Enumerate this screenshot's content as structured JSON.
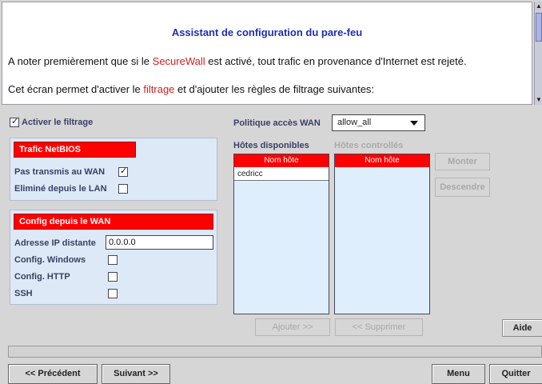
{
  "info": {
    "title": "Assistant de configuration du pare-feu",
    "line1_pre": "A noter premièrement que si le ",
    "line1_link": "SecureWall",
    "line1_post": " est activé, tout trafic en provenance d'Internet est rejeté.",
    "line2_pre": "Cet écran permet d'activer le ",
    "line2_link": "filtrage",
    "line2_post": " et d'ajouter les règles de filtrage suivantes:"
  },
  "filter": {
    "enable_label": "Activer le filtrage",
    "enabled": true
  },
  "netbios": {
    "header": "Trafic NetBIOS",
    "not_sent_wan_label": "Pas transmis au WAN",
    "not_sent_wan_checked": true,
    "removed_lan_label": "Eliminé depuis le LAN",
    "removed_lan_checked": false
  },
  "wan_config": {
    "header": "Config depuis le WAN",
    "remote_ip_label": "Adresse IP distante",
    "remote_ip_value": "0.0.0.0",
    "windows_label": "Config. Windows",
    "windows_checked": false,
    "http_label": "Config. HTTP",
    "http_checked": false,
    "ssh_label": "SSH",
    "ssh_checked": false
  },
  "policy": {
    "label": "Politique accès WAN",
    "selected": "allow_all"
  },
  "hosts": {
    "available_label": "Hôtes disponibles",
    "controlled_label": "Hôtes controllés",
    "column_header": "Nom hôte",
    "available": [
      "cedricc"
    ],
    "controlled": []
  },
  "buttons": {
    "up": "Monter",
    "down": "Descendre",
    "add": "Ajouter >>",
    "remove": "<< Supprimer",
    "help": "Aide",
    "previous": "<< Précédent",
    "next": "Suivant >>",
    "menu": "Menu",
    "quit": "Quitter"
  }
}
